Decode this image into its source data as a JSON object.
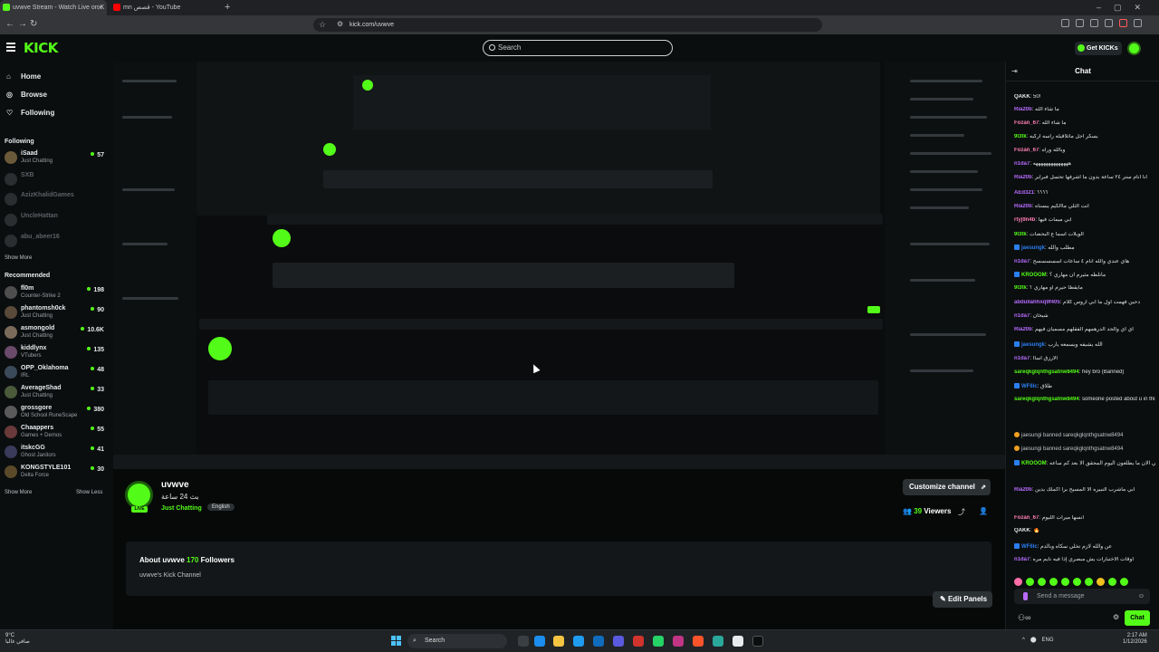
{
  "browser": {
    "tabs": [
      {
        "title": "uvwve Stream - Watch Live on K",
        "active": true
      },
      {
        "title": "mn قصص - YouTube",
        "active": false
      }
    ],
    "url": "kick.com/uvwve"
  },
  "header": {
    "logo": "KICK",
    "search_placeholder": "Search",
    "get_kicks": "Get KICKs"
  },
  "sidebar": {
    "nav": [
      {
        "label": "Home",
        "icon": "home-icon"
      },
      {
        "label": "Browse",
        "icon": "compass-icon"
      },
      {
        "label": "Following",
        "icon": "heart-icon"
      }
    ],
    "following_heading": "Following",
    "following": [
      {
        "name": "iSaad",
        "category": "Just Chatting",
        "viewers": "57",
        "online": true
      },
      {
        "name": "SXB",
        "category": "",
        "viewers": "",
        "online": false
      },
      {
        "name": "AzizKhalidGames",
        "category": "",
        "viewers": "",
        "online": false
      },
      {
        "name": "UncleHattan",
        "category": "",
        "viewers": "",
        "online": false
      },
      {
        "name": "abu_abeer16",
        "category": "",
        "viewers": "",
        "online": false
      }
    ],
    "show_more": "Show More",
    "recommended_heading": "Recommended",
    "recommended": [
      {
        "name": "fl0m",
        "category": "Counter-Strike 2",
        "viewers": "198"
      },
      {
        "name": "phantomsh0ck",
        "category": "Just Chatting",
        "viewers": "90"
      },
      {
        "name": "asmongold",
        "category": "Just Chatting",
        "viewers": "10.6K"
      },
      {
        "name": "kiddlynx",
        "category": "VTubers",
        "viewers": "135"
      },
      {
        "name": "OPP_Oklahoma",
        "category": "IRL",
        "viewers": "48"
      },
      {
        "name": "AverageShad",
        "category": "Just Chatting",
        "viewers": "33"
      },
      {
        "name": "grossgore",
        "category": "Old School RuneScape",
        "viewers": "380"
      },
      {
        "name": "Chaappers",
        "category": "Games + Demos",
        "viewers": "55"
      },
      {
        "name": "itskcGG",
        "category": "Ghost Janitors",
        "viewers": "41"
      },
      {
        "name": "KONGSTYLE101",
        "category": "Delta Force",
        "viewers": "30"
      }
    ],
    "show_less": "Show Less"
  },
  "channel": {
    "name": "uvwve",
    "title": "بث 24 ساعة",
    "category": "Just Chatting",
    "language": "English",
    "customize": "Customize channel",
    "viewers": "39",
    "viewers_label": "Viewers",
    "about_title": "About uvwve",
    "followers": "170",
    "followers_label": "Followers",
    "description": "uvwve's Kick Channel",
    "edit_panels": "Edit Panels",
    "live": "LIVE"
  },
  "chat": {
    "title": "Chat",
    "messages": [
      {
        "user": "QAKK",
        "color": "#e8eaed",
        "text": "50!",
        "badge": false
      },
      {
        "user": "Ria20b",
        "color": "#b76cff",
        "text": "ما شاء الله",
        "badge": false
      },
      {
        "user": "Fozan_67",
        "color": "#ff7eb6",
        "text": "ما شاء الله",
        "badge": false
      },
      {
        "user": "9l3tk",
        "color": "#53fc18",
        "text": "يسكر اجل ماتلاقيله راسه اركبه",
        "badge": false
      },
      {
        "user": "Fozan_67",
        "color": "#ff7eb6",
        "text": "وبالله وراه",
        "badge": false
      },
      {
        "user": "n1da7",
        "color": "#b76cff",
        "text": "ههههههههههههههه",
        "badge": false
      },
      {
        "user": "Ria20b",
        "color": "#b76cff",
        "text": "انا انام ستر ٢٤ ساعة بدون ما اشرفها تحسل فبراير",
        "badge": false
      },
      {
        "user": "AEd321",
        "color": "#b76cff",
        "text": "؟؟؟؟",
        "badge": false
      },
      {
        "user": "Ria20b",
        "color": "#b76cff",
        "text": "انت الثلي ماالكيم يبسناه",
        "badge": false
      },
      {
        "user": "rtyj9n4b",
        "color": "#ff7eb6",
        "text": "ابي ميمات فيها",
        "badge": false
      },
      {
        "user": "9l3tk",
        "color": "#53fc18",
        "text": "الويلات اسما ع البحضات",
        "badge": false
      },
      {
        "user": "jaesungk",
        "color": "#2a7ff0",
        "text": "مطلب والله",
        "badge": true
      },
      {
        "user": "n1da7",
        "color": "#b76cff",
        "text": "هاي عندي والله انام ٤ ساعات اسسسسسح",
        "badge": false
      },
      {
        "user": "KROOOM",
        "color": "#53fc18",
        "text": "ماتلطه مثيرم ان مهاري ؟",
        "badge": true
      },
      {
        "user": "9l3tk",
        "color": "#53fc18",
        "text": "مايقطا حيرم او مهاري ؟",
        "badge": false
      },
      {
        "user": "abdullahhxq9f405",
        "color": "#b76cff",
        "text": "دحين فهمت اول ما ابي اروس كلام",
        "badge": false
      },
      {
        "user": "n1da7",
        "color": "#b76cff",
        "text": "شيخان",
        "badge": false
      },
      {
        "user": "Ria20b",
        "color": "#b76cff",
        "text": "اي اي والحد الدرهمهم الفقلهم مسميان فيهم",
        "badge": false
      },
      {
        "user": "jaesungk",
        "color": "#2a7ff0",
        "text": "الله يشيفه ويسمعه يارب",
        "badge": true
      },
      {
        "user": "n1da7",
        "color": "#b76cff",
        "text": "الارزق اساا",
        "badge": false
      },
      {
        "user": "sareqkglqnthgsatnw8494",
        "color": "#53fc18",
        "text": "hey bro (Banned)",
        "badge": false
      },
      {
        "user": "WF6lc",
        "color": "#2a7ff0",
        "text": "طلاق",
        "badge": true
      },
      {
        "user": "sareqkglqnthgsatnw8494",
        "color": "#53fc18",
        "text": "someone posted about u in this discord- discord. gg/MeRVtRSqA (Banned)",
        "badge": false
      },
      {
        "user": "",
        "color": "#bfc3c7",
        "text": "jaesungi banned sareqkglqnthgsatnw8494",
        "badge": false,
        "banned": true
      },
      {
        "user": "",
        "color": "#bfc3c7",
        "text": "jaesungi banned sareqkglqnthgsatnw8494",
        "badge": false,
        "banned": true
      },
      {
        "user": "KROOOM",
        "color": "#53fc18",
        "text": "شف فيه ناس يطولون ياولي الان ما يطلعون اليوم المحقق الا بعد كم ساعه",
        "badge": true
      },
      {
        "user": "Ria20b",
        "color": "#b76cff",
        "text": "ابي ماشرب النبيره الا المسيح برا اكملك يدين",
        "badge": false
      },
      {
        "user": "Fozan_67",
        "color": "#ff7eb6",
        "text": "انسها ميرات الليوم",
        "badge": false
      },
      {
        "user": "QAKK",
        "color": "#e8eaed",
        "text": "🔥",
        "badge": false
      },
      {
        "user": "WF6lc",
        "color": "#2a7ff0",
        "text": "عن والله لازم تخلي سكاه وبالدم",
        "badge": true
      },
      {
        "user": "n1da7",
        "color": "#b76cff",
        "text": "أوقات الاختبارات يش مبصري إذا فيه نايم مره",
        "badge": false
      }
    ],
    "input_placeholder": "Send a message",
    "send": "Chat"
  },
  "taskbar": {
    "weather_temp": "9°C",
    "weather_desc": "صافي غالبا",
    "search": "Search",
    "lang": "ENG",
    "time": "2:17 AM",
    "date": "1/12/2026"
  }
}
